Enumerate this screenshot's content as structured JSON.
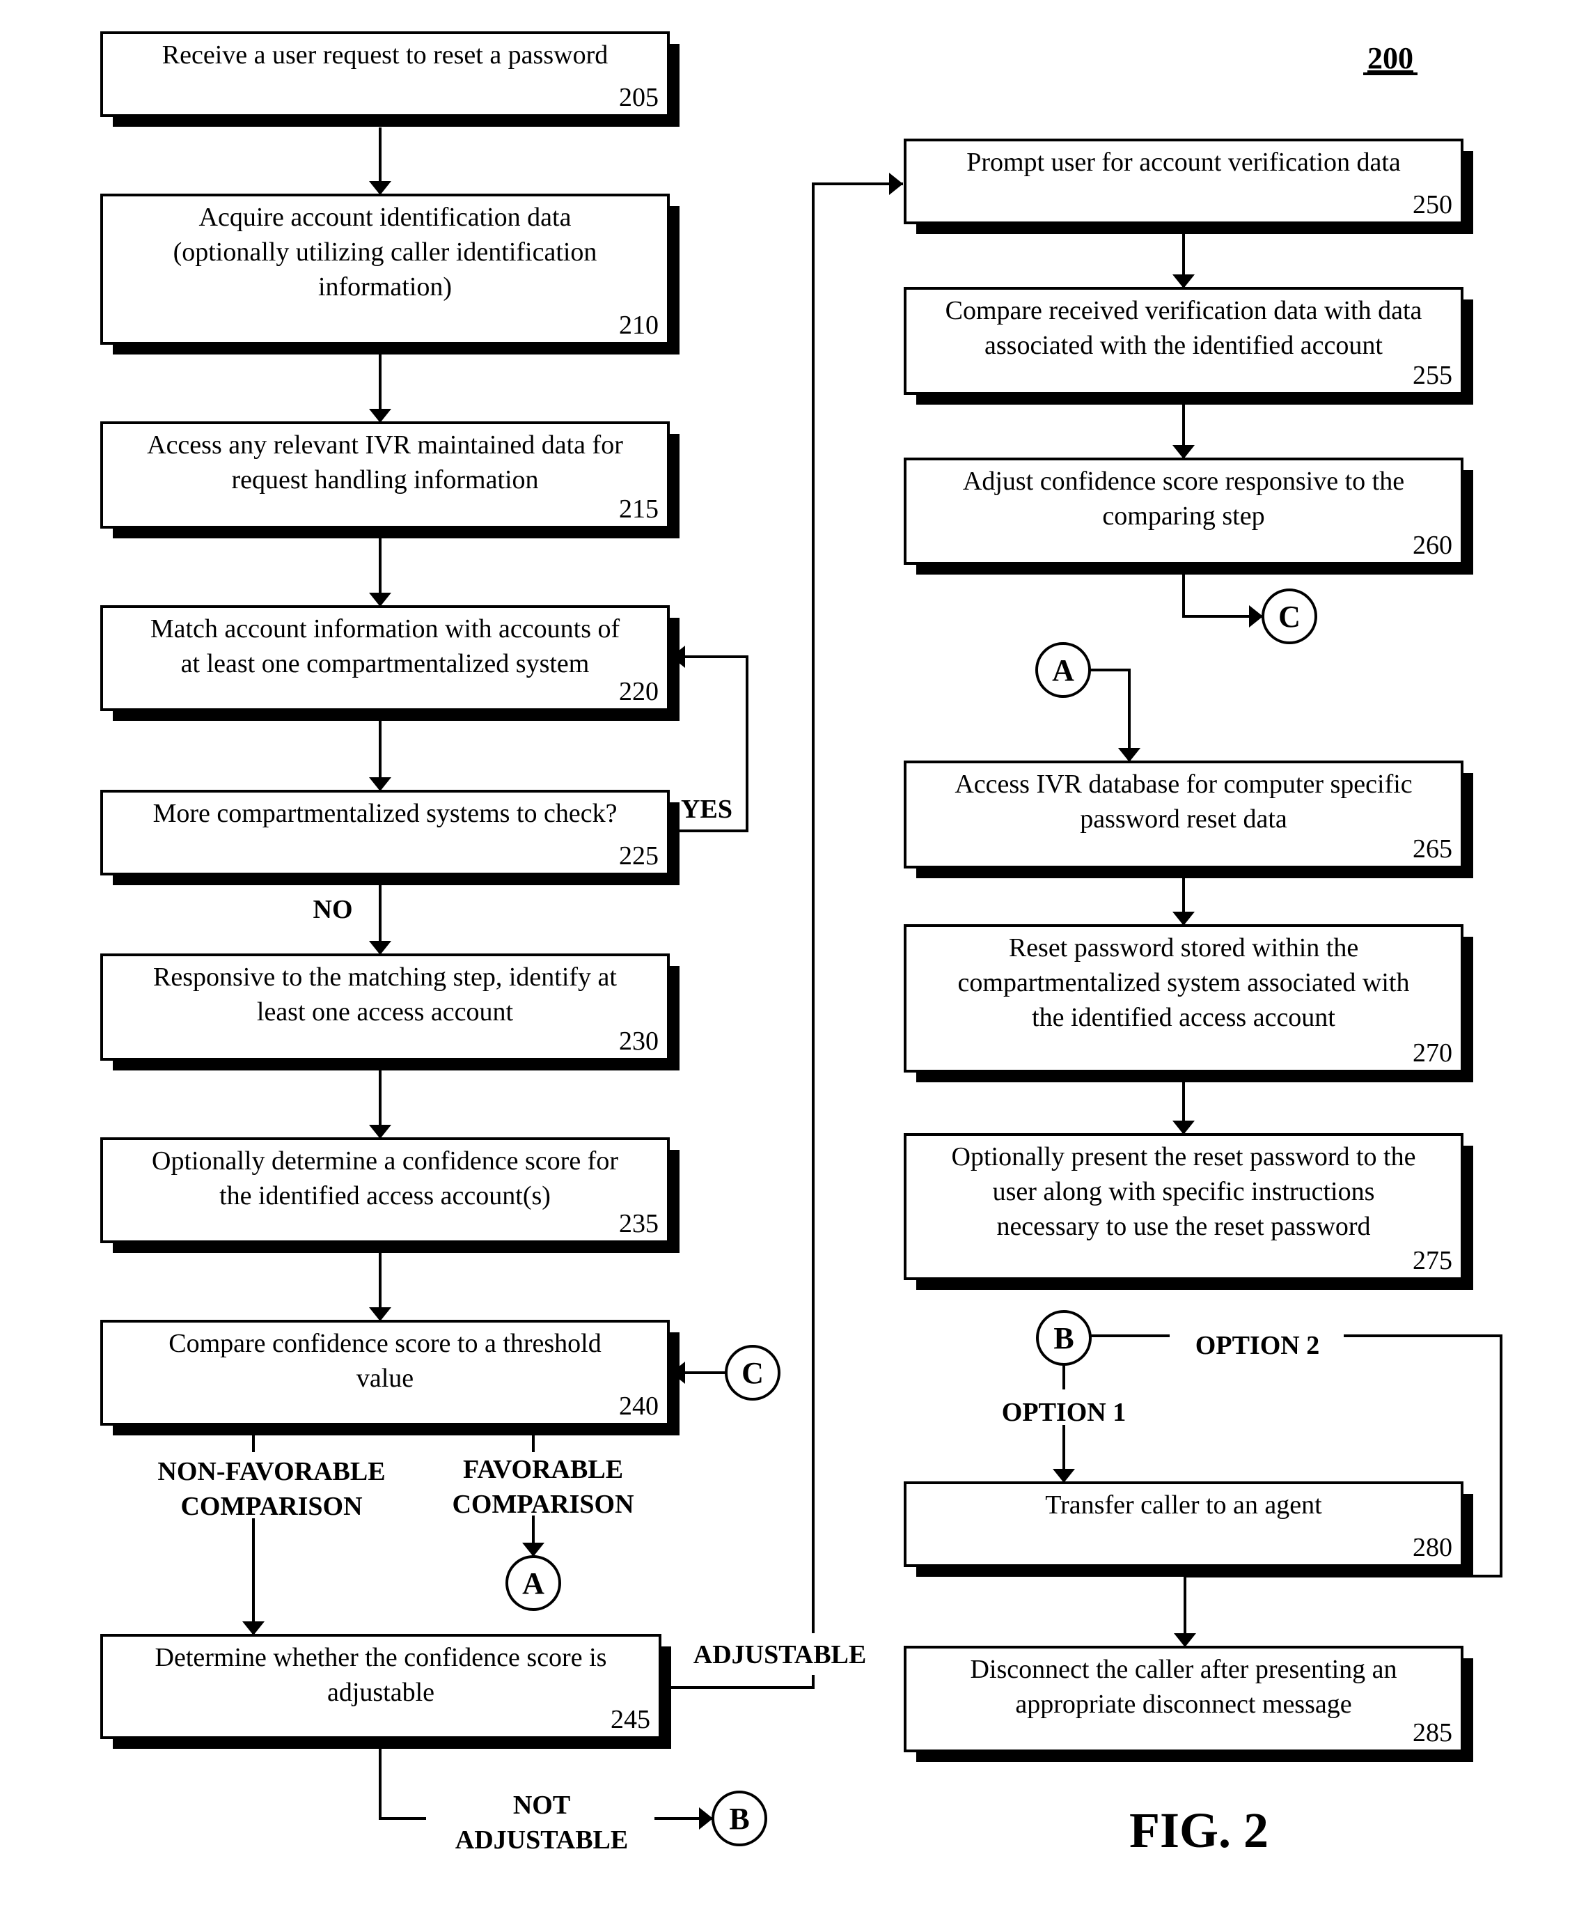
{
  "figure": {
    "number": "200",
    "caption": "FIG. 2"
  },
  "steps": [
    {
      "id": "205",
      "lines": [
        "Receive a user request to reset a password"
      ]
    },
    {
      "id": "210",
      "lines": [
        "Acquire account identification data",
        "(optionally utilizing caller identification",
        "information)"
      ]
    },
    {
      "id": "215",
      "lines": [
        "Access any relevant IVR maintained data for",
        "request handling information"
      ]
    },
    {
      "id": "220",
      "lines": [
        "Match account information with accounts of",
        "at least one compartmentalized system"
      ]
    },
    {
      "id": "225",
      "lines": [
        "More compartmentalized systems to check?"
      ]
    },
    {
      "id": "230",
      "lines": [
        "Responsive to the matching step, identify at",
        "least one access account"
      ]
    },
    {
      "id": "235",
      "lines": [
        "Optionally determine a confidence score for",
        "the identified access account(s)"
      ]
    },
    {
      "id": "240",
      "lines": [
        "Compare confidence score to a threshold",
        "value"
      ]
    },
    {
      "id": "245",
      "lines": [
        "Determine whether the confidence score is",
        "adjustable"
      ]
    },
    {
      "id": "250",
      "lines": [
        "Prompt user for account verification data"
      ]
    },
    {
      "id": "255",
      "lines": [
        "Compare received verification data with data",
        "associated with the identified account"
      ]
    },
    {
      "id": "260",
      "lines": [
        "Adjust confidence score responsive to the",
        "comparing step"
      ]
    },
    {
      "id": "265",
      "lines": [
        "Access IVR database for computer specific",
        "password reset data"
      ]
    },
    {
      "id": "270",
      "lines": [
        "Reset password stored within the",
        "compartmentalized system associated with",
        "the identified access account"
      ]
    },
    {
      "id": "275",
      "lines": [
        "Optionally present the reset password to the",
        "user along with specific instructions",
        "necessary to use the reset password"
      ]
    },
    {
      "id": "280",
      "lines": [
        "Transfer caller to an agent"
      ]
    },
    {
      "id": "285",
      "lines": [
        "Disconnect the caller after presenting an",
        "appropriate disconnect message"
      ]
    }
  ],
  "labels": {
    "yes": "YES",
    "no": "NO",
    "non_favorable": [
      "NON-FAVORABLE",
      "COMPARISON"
    ],
    "favorable": [
      "FAVORABLE",
      "COMPARISON"
    ],
    "adjustable": "ADJUSTABLE",
    "not_adjustable": [
      "NOT",
      "ADJUSTABLE"
    ],
    "option1": "OPTION 1",
    "option2": "OPTION 2"
  },
  "connectors": {
    "a": "A",
    "b": "B",
    "c": "C"
  }
}
